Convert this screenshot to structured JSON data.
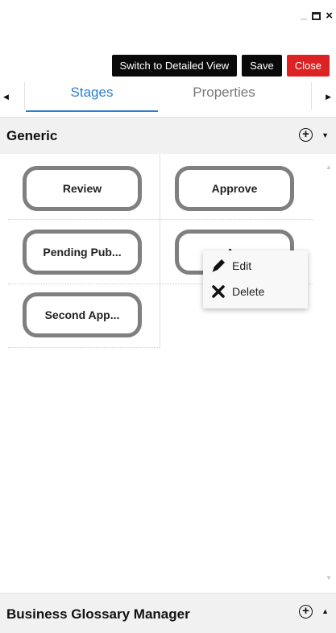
{
  "window_controls": {
    "minimize": "_",
    "maximize": "",
    "close": "×"
  },
  "toolbar": {
    "switch_view_label": "Switch to Detailed View",
    "save_label": "Save",
    "close_label": "Close"
  },
  "tabs": {
    "left_arrow": "◀",
    "right_arrow": "▶",
    "items": [
      {
        "label": "Stages",
        "active": true
      },
      {
        "label": "Properties",
        "active": false
      }
    ]
  },
  "sections": {
    "generic": {
      "title": "Generic",
      "add": "+",
      "chevron": "▼"
    },
    "business_glossary": {
      "title": "Business Glossary Manager",
      "add": "+",
      "chevron": "▲"
    }
  },
  "stages": [
    {
      "label": "Review"
    },
    {
      "label": "Approve"
    },
    {
      "label": "Pending Pub..."
    },
    {
      "label": "A..."
    },
    {
      "label": "Second App..."
    }
  ],
  "context_menu": {
    "edit_label": "Edit",
    "delete_label": "Delete",
    "edit_icon": "pencil-icon",
    "delete_icon": "x-icon"
  },
  "scrollbar": {
    "up": "▲",
    "down": "▼"
  },
  "colors": {
    "accent": "#2a7fd4",
    "close_button": "#dc2222",
    "dark_button": "#0a0a0a",
    "stage_border": "#7f7f7f"
  }
}
